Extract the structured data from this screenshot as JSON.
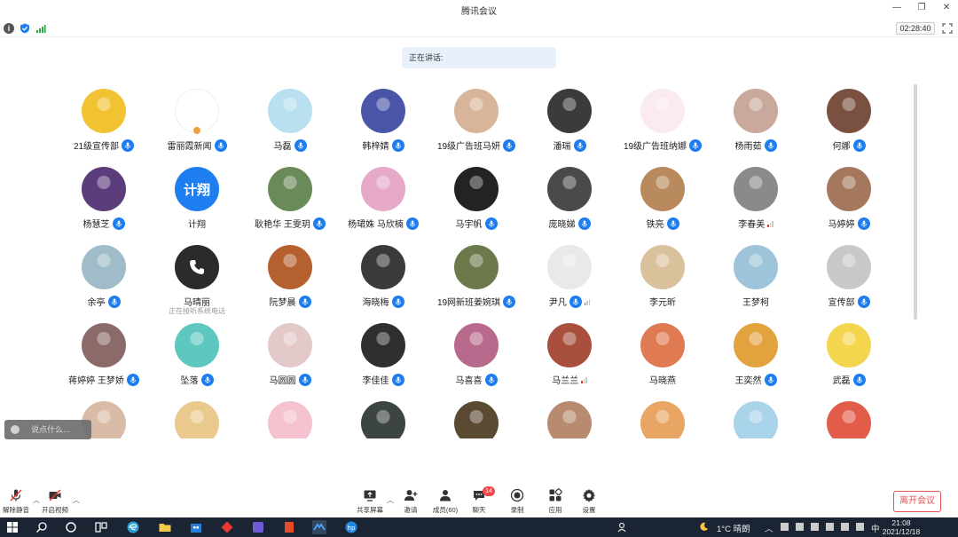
{
  "window": {
    "title": "腾讯会议",
    "min": "—",
    "max": "❐",
    "close": "✕"
  },
  "info": {
    "timer": "02:28:40"
  },
  "speaking": {
    "label": "正在讲话:"
  },
  "participants": [
    {
      "name": "21级宣传部",
      "mic": "on",
      "bg": "#f1c232"
    },
    {
      "name": "雷丽霞新闻",
      "mic": "on",
      "bg": "#ffffff",
      "host": true
    },
    {
      "name": "马磊",
      "mic": "on",
      "bg": "#b9e0f0"
    },
    {
      "name": "韩梓婧",
      "mic": "on",
      "bg": "#4a55a8"
    },
    {
      "name": "19级广告班马妍",
      "mic": "on",
      "bg": "#d8b59a"
    },
    {
      "name": "潘瑞",
      "mic": "on",
      "bg": "#3b3b3b"
    },
    {
      "name": "19级广告班纳娜",
      "mic": "on",
      "bg": "#fbeaee"
    },
    {
      "name": "杨雨茹",
      "mic": "on",
      "bg": "#c9a99b"
    },
    {
      "name": "何娜",
      "mic": "on",
      "bg": "#7a5040"
    },
    {
      "name": "杨慧芝",
      "mic": "on",
      "bg": "#5b3d7c"
    },
    {
      "name": "计翔",
      "mic": "none",
      "text": "计翔"
    },
    {
      "name": "耿艳华 王雯玥",
      "mic": "on",
      "bg": "#6b8a5a"
    },
    {
      "name": "杨珺姝 马欣楠",
      "mic": "on",
      "bg": "#e7a9c8"
    },
    {
      "name": "马宇帆",
      "mic": "on",
      "bg": "#232323"
    },
    {
      "name": "庞晓娣",
      "mic": "on",
      "bg": "#4a4a4a"
    },
    {
      "name": "铁亮",
      "mic": "on",
      "bg": "#b98a5d"
    },
    {
      "name": "李春美",
      "mic": "signal",
      "bg": "#8a8a8a"
    },
    {
      "name": "马婷婷",
      "mic": "on",
      "bg": "#a5785e"
    },
    {
      "name": "余亭",
      "mic": "on",
      "bg": "#9fbcc8"
    },
    {
      "name": "马晴丽",
      "mic": "none",
      "phone": true,
      "sub": "正在接听系统电话"
    },
    {
      "name": "阮梦晨",
      "mic": "on",
      "bg": "#b5612f"
    },
    {
      "name": "海晓梅",
      "mic": "on",
      "bg": "#3a3a3a"
    },
    {
      "name": "19网新班姜婉琪",
      "mic": "on",
      "bg": "#6c7a4b"
    },
    {
      "name": "尹凡",
      "mic": "signal-on",
      "bg": "#e9e9e9"
    },
    {
      "name": "李元昕",
      "mic": "none",
      "bg": "#d9c29b"
    },
    {
      "name": "王梦柯",
      "mic": "none",
      "bg": "#9dc4d8"
    },
    {
      "name": "宣传部",
      "mic": "on",
      "bg": "#c8c8c8"
    },
    {
      "name": "蒋婷婷 王梦娇",
      "mic": "on",
      "bg": "#8b6a6a"
    },
    {
      "name": "坠落",
      "mic": "on",
      "bg": "#5ec8c0"
    },
    {
      "name": "马圆圆",
      "mic": "on",
      "bg": "#e3c9c9"
    },
    {
      "name": "李佳佳",
      "mic": "on",
      "bg": "#2f2f2f"
    },
    {
      "name": "马喜喜",
      "mic": "on",
      "bg": "#b86a8c"
    },
    {
      "name": "马兰兰",
      "mic": "signal",
      "bg": "#a94f3d"
    },
    {
      "name": "马晓燕",
      "mic": "none",
      "bg": "#e07a52"
    },
    {
      "name": "王奕然",
      "mic": "on",
      "bg": "#e2a33f"
    },
    {
      "name": "武磊",
      "mic": "on",
      "bg": "#f3d54e"
    },
    {
      "name": "",
      "mic": "none",
      "bg": "#d9bca7"
    },
    {
      "name": "",
      "mic": "none",
      "bg": "#e9c98c"
    },
    {
      "name": "",
      "mic": "none",
      "bg": "#f4c3cf"
    },
    {
      "name": "",
      "mic": "none",
      "bg": "#3d4540"
    },
    {
      "name": "",
      "mic": "none",
      "bg": "#5a4a32"
    },
    {
      "name": "",
      "mic": "none",
      "bg": "#b88a70"
    },
    {
      "name": "",
      "mic": "none",
      "bg": "#e8a564"
    },
    {
      "name": "",
      "mic": "none",
      "bg": "#a9d3e9"
    },
    {
      "name": "",
      "mic": "none",
      "bg": "#e25c4a"
    }
  ],
  "chat": {
    "placeholder": "说点什么..."
  },
  "toolbar": {
    "unmute": "解除静音",
    "start_video": "开启视频",
    "share_screen": "共享屏幕",
    "invite": "邀请",
    "members": "成员(60)",
    "chat": "聊天",
    "chat_badge": "14",
    "record": "录制",
    "apps": "应用",
    "settings": "设置",
    "leave": "离开会议"
  },
  "taskbar": {
    "weather": "1°C 晴朗",
    "ime": "中",
    "time": "21:08",
    "date": "2021/12/18"
  },
  "colors": {
    "accent": "#1e7ef0",
    "leave": "#e05454",
    "taskbar": "#1b2433"
  }
}
